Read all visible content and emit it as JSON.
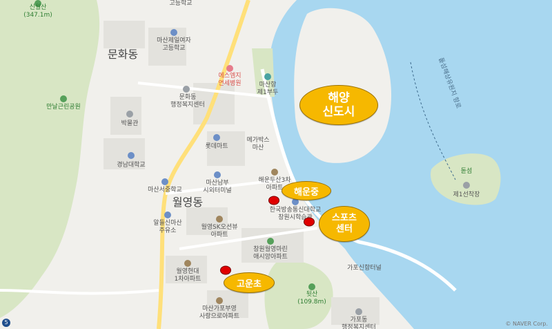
{
  "map": {
    "colors": {
      "land": "#f1f0ec",
      "sea": "#a8d7f0",
      "hill": "#d8e6c4",
      "road": "#ffe07a",
      "callout": "#f6b800",
      "marker": "#e00000"
    },
    "callouts": {
      "marine_new_city": "해양\n신도시",
      "haeunjung": "해운중",
      "sports_center": "스포츠\n센터",
      "goun_elementary": "고운초"
    },
    "neighborhoods": {
      "munhwa": "문화동",
      "wolyeong": "월영동"
    },
    "labels": {
      "sinwolsan": "신월산",
      "sinwolsan_height": "(347.1m)",
      "gopung_school": "고등학교",
      "masan_jeil_girls_hs": "마산제일여자\n고등학교",
      "masan_dojo": "마산항\n제1부두",
      "sm_hospital": "에스엠지\n연세병원",
      "munhwa_center": "문화동\n행정복지센터",
      "manal_park": "만날근린공원",
      "museum": "박물관",
      "lotte_mart": "롯데마트",
      "megabox": "메가박스\n마산",
      "kyungnam_univ": "경남대학교",
      "masan_nambu_terminal": "마산남부\n시외터미널",
      "haeundusan_apt": "해운두산3차\n아파트",
      "masanseo_ms": "마산서중학교",
      "knou": "한국방송통신대학교\n창원시학습관",
      "wolyeong_sk_apt": "월영SK오션뷰\n아파트",
      "aldeul_masan_school": "알들신마산\n주유소",
      "changwon_marina": "창원월영마린\n애시앙아파트",
      "wolyeong_hyundai": "월영현대\n1차아파트",
      "gapo_ferry": "가포신항터널",
      "dwitsan": "뒷산",
      "dwitsan_height": "(109.8m)",
      "masan_gapo_apt": "마산가포부영\n사랑으로아파트",
      "gapo_center": "가포동\n행정복지센터",
      "dotseom": "돋섬",
      "dotseom_pier": "제1선착장",
      "sea_route": "돝섬해상유원지 항로",
      "naver": "© NAVER Corp."
    },
    "route_badge": "5",
    "markers": [
      "school-marker",
      "school-marker",
      "school-marker"
    ]
  }
}
